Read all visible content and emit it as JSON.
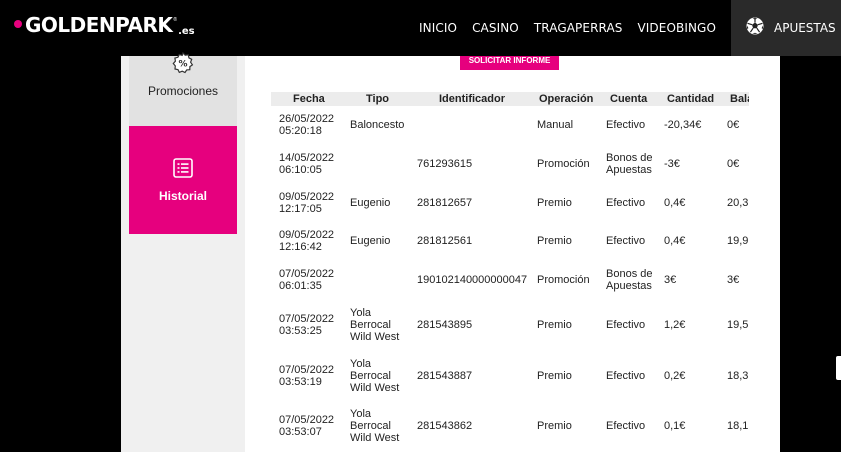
{
  "header": {
    "logo_text": "GOLDENPARK",
    "logo_suffix": ".es",
    "logo_reg": "®",
    "nav": [
      "INICIO",
      "CASINO",
      "TRAGAPERRAS",
      "VIDEOBINGO"
    ],
    "bets_label": "APUESTAS"
  },
  "sidebar": {
    "promotions_label": "Promociones",
    "history_label": "Historial"
  },
  "report_button_label": "SOLICITAR INFORME",
  "table": {
    "headers": [
      "Fecha",
      "Tipo",
      "Identificador",
      "Operación",
      "Cuenta",
      "Cantidad",
      "Balance"
    ],
    "rows": [
      {
        "date": "26/05/2022\n05:20:18",
        "type": "Baloncesto",
        "id": "",
        "operation": "Manual",
        "account": "Efectivo",
        "amount": "-20,34€",
        "balance": "0€"
      },
      {
        "date": "14/05/2022\n06:10:05",
        "type": "",
        "id": "761293615",
        "operation": "Promoción",
        "account": "Bonos de\nApuestas",
        "amount": "-3€",
        "balance": "0€"
      },
      {
        "date": "09/05/2022\n12:17:05",
        "type": "Eugenio",
        "id": "281812657",
        "operation": "Premio",
        "account": "Efectivo",
        "amount": "0,4€",
        "balance": "20,3"
      },
      {
        "date": "09/05/2022\n12:16:42",
        "type": "Eugenio",
        "id": "281812561",
        "operation": "Premio",
        "account": "Efectivo",
        "amount": "0,4€",
        "balance": "19,9"
      },
      {
        "date": "07/05/2022\n06:01:35",
        "type": "",
        "id": "190102140000000047",
        "operation": "Promoción",
        "account": "Bonos de\nApuestas",
        "amount": "3€",
        "balance": "3€"
      },
      {
        "date": "07/05/2022\n03:53:25",
        "type": "Yola\nBerrocal\nWild West",
        "id": "281543895",
        "operation": "Premio",
        "account": "Efectivo",
        "amount": "1,2€",
        "balance": "19,5"
      },
      {
        "date": "07/05/2022\n03:53:19",
        "type": "Yola\nBerrocal\nWild West",
        "id": "281543887",
        "operation": "Premio",
        "account": "Efectivo",
        "amount": "0,2€",
        "balance": "18,3"
      },
      {
        "date": "07/05/2022\n03:53:07",
        "type": "Yola\nBerrocal\nWild West",
        "id": "281543862",
        "operation": "Premio",
        "account": "Efectivo",
        "amount": "0,1€",
        "balance": "18,1"
      }
    ]
  },
  "colors": {
    "brand_pink": "#e6007e",
    "top_bar": "#000000",
    "bets_tab": "#2a2a2a"
  },
  "icons": {
    "promotions": "percent-badge-icon",
    "history": "list-icon",
    "bets": "soccer-ball-icon"
  }
}
